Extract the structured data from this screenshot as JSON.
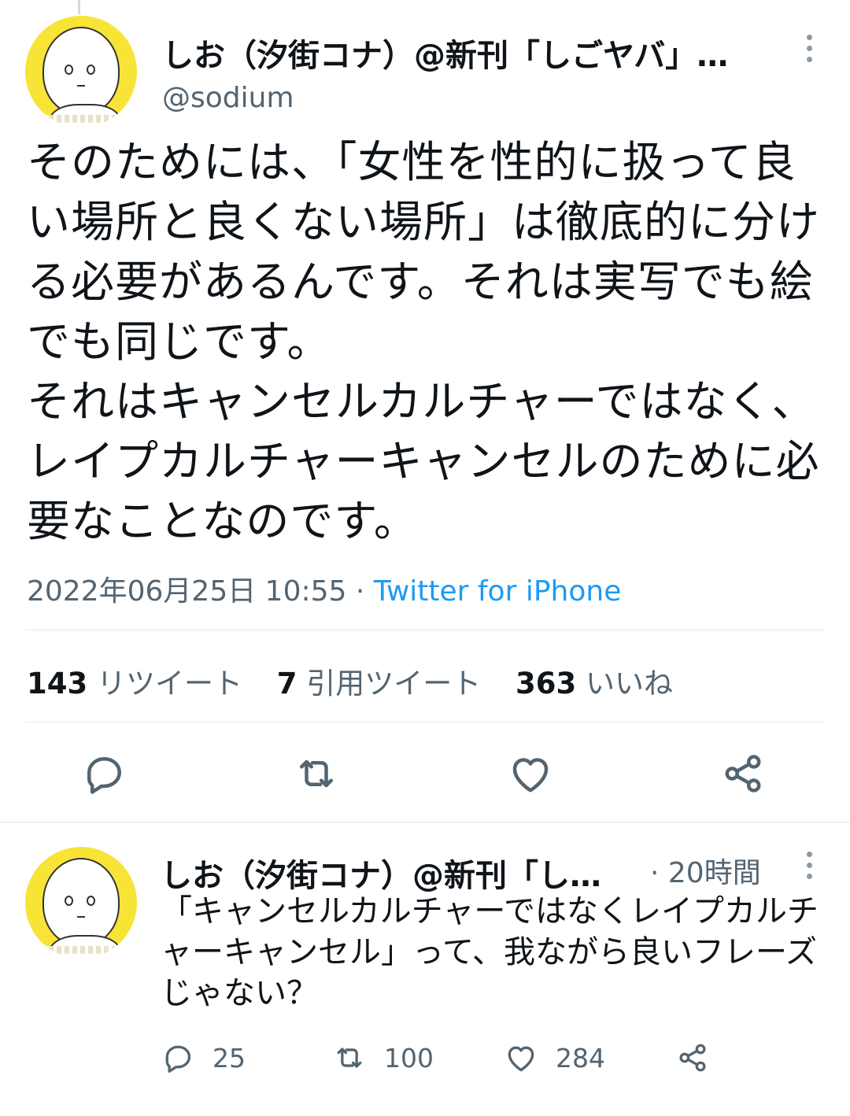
{
  "main_tweet": {
    "author_name": "しお（汐街コナ）@新刊「しごヤバ」…",
    "handle": "@sodium",
    "text": "そのためには、「女性を性的に扱って良い場所と良くない場所」は徹底的に分ける必要があるんです。それは実写でも絵でも同じです。\nそれはキャンセルカルチャーではなく、レイプカルチャーキャンセルのために必要なことなのです。",
    "timestamp": "2022年06月25日 10:55",
    "separator": " · ",
    "source": "Twitter for iPhone",
    "stats": {
      "retweets_count": "143",
      "retweets_label": "リツイート",
      "quotes_count": "7",
      "quotes_label": "引用ツイート",
      "likes_count": "363",
      "likes_label": "いいね"
    },
    "icons": [
      "reply-icon",
      "retweet-icon",
      "like-icon",
      "share-icon",
      "more-icon"
    ]
  },
  "reply_tweet": {
    "author_name": "しお（汐街コナ）@新刊「し…",
    "time": "· 20時間",
    "text": "「キャンセルカルチャーではなくレイプカルチャーキャンセル」って、我ながら良いフレーズじゃない？",
    "reply_count": "25",
    "retweet_count": "100",
    "like_count": "284"
  },
  "colors": {
    "text": "#0f1419",
    "secondary": "#536471",
    "link": "#1d9bf0",
    "avatar_bg": "#f8e437"
  }
}
